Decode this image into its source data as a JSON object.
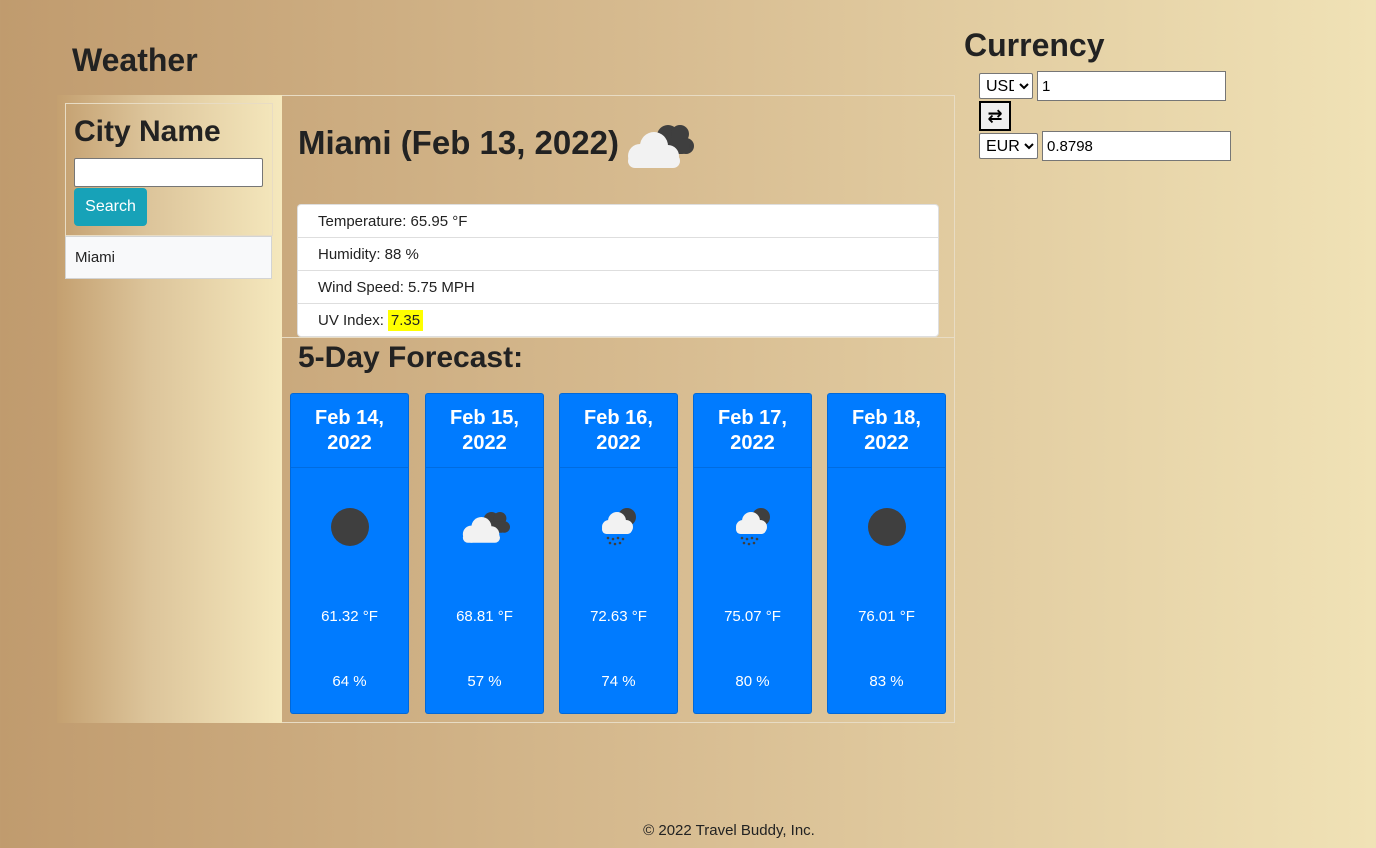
{
  "weather": {
    "title": "Weather",
    "city_label": "City Name",
    "city_input_value": "",
    "search_label": "Search",
    "history": [
      "Miami"
    ]
  },
  "current": {
    "heading": "Miami (Feb 13, 2022)",
    "icon": "broken-clouds-icon",
    "temperature": "Temperature: 65.95 °F",
    "humidity": "Humidity: 88 %",
    "wind": "Wind Speed: 5.75 MPH",
    "uv_label": "UV Index:",
    "uv_value": "7.35"
  },
  "forecast": {
    "title": "5-Day Forecast:",
    "days": [
      {
        "date": "Feb 14, 2022",
        "icon": "dark-circle-icon",
        "temp": "61.32 °F",
        "humidity": "64 %"
      },
      {
        "date": "Feb 15, 2022",
        "icon": "broken-clouds-icon",
        "temp": "68.81 °F",
        "humidity": "57 %"
      },
      {
        "date": "Feb 16, 2022",
        "icon": "rain-cloud-icon",
        "temp": "72.63 °F",
        "humidity": "74 %"
      },
      {
        "date": "Feb 17, 2022",
        "icon": "rain-cloud-icon",
        "temp": "75.07 °F",
        "humidity": "80 %"
      },
      {
        "date": "Feb 18, 2022",
        "icon": "dark-circle-icon",
        "temp": "76.01 °F",
        "humidity": "83 %"
      }
    ]
  },
  "currency": {
    "title": "Currency",
    "from_code": "USD",
    "from_value": "1",
    "swap_symbol": "⇄",
    "to_code": "EUR",
    "to_value": "0.8798"
  },
  "footer": {
    "text": "© 2022 Travel Buddy, Inc."
  },
  "colors": {
    "card_blue": "#007bff",
    "search_teal": "#17a2b8",
    "uv_highlight": "#ffff00"
  }
}
